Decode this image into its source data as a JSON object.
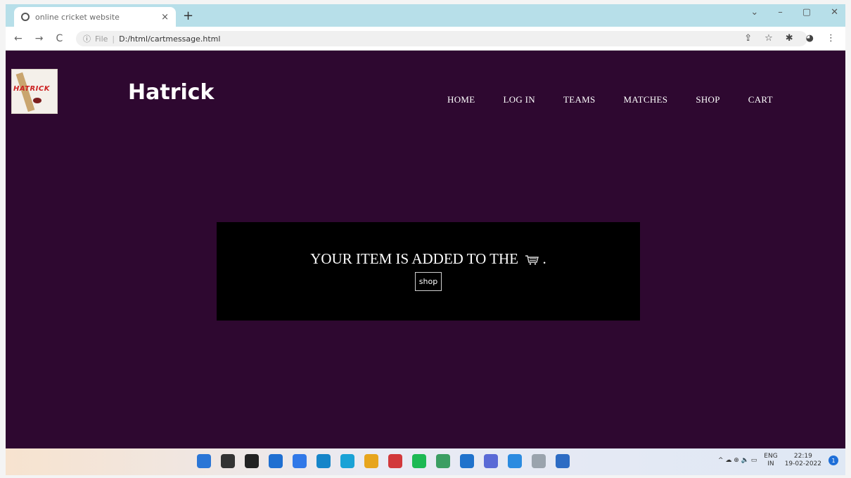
{
  "browser": {
    "tab_title": "online cricket website",
    "tab_close": "×",
    "new_tab": "+",
    "window_controls": [
      "⌄",
      "–",
      "▢",
      "✕"
    ],
    "nav_buttons": [
      "←",
      "→",
      "C"
    ],
    "url_info": "ⓘ",
    "url_scheme": "File",
    "url_sep": "|",
    "url": "D:/html/cartmessage.html",
    "right_icons": [
      "⇪",
      "☆",
      "✱",
      "◕",
      "⋮"
    ]
  },
  "site": {
    "logo_text": "HATRICK",
    "brand": "Hatrick",
    "nav": [
      "HOME",
      "LOG IN",
      "TEAMS",
      "MATCHES",
      "SHOP",
      "CART"
    ]
  },
  "message": {
    "text": "YOUR ITEM IS ADDED TO THE",
    "suffix": ".",
    "button": "shop"
  },
  "taskbar": {
    "icon_colors": [
      "#2b76d6",
      "#333333",
      "#222222",
      "#1f6fd1",
      "#3178e8",
      "#1685c9",
      "#1aa2d6",
      "#e7a51e",
      "#d2383b",
      "#1db954",
      "#3c9e63",
      "#1f72cc",
      "#5a6ad6",
      "#2b8be0",
      "#9aa3ad",
      "#2d6cc4"
    ],
    "lang_top": "ENG",
    "lang_bottom": "IN",
    "time": "22:19",
    "date": "19-02-2022",
    "notifications": "1",
    "tray_icons": "^ ☁   ⊕ 🔈 ▭"
  }
}
